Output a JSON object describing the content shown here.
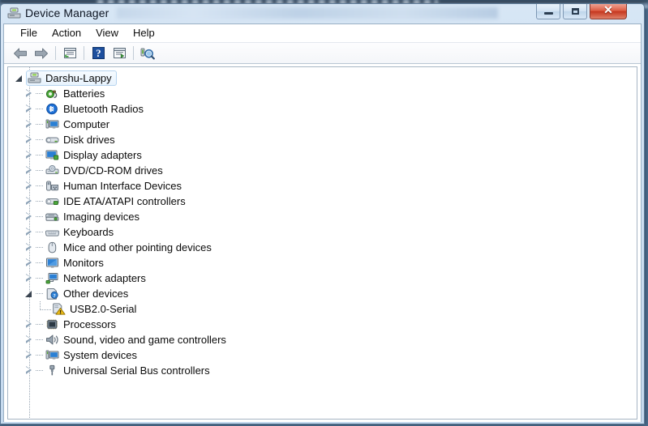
{
  "window": {
    "title": "Device Manager",
    "title_icon": "device-manager-icon",
    "has_blurred_title_region": true,
    "buttons": {
      "minimize": "minimize-button",
      "maximize": "maximize-button",
      "close": "close-button",
      "close_glyph": "✕"
    }
  },
  "menubar": {
    "items": [
      {
        "label": "File",
        "name": "menu-file"
      },
      {
        "label": "Action",
        "name": "menu-action"
      },
      {
        "label": "View",
        "name": "menu-view"
      },
      {
        "label": "Help",
        "name": "menu-help"
      }
    ]
  },
  "toolbar": {
    "items": [
      {
        "name": "back-button",
        "icon": "back-arrow-icon",
        "type": "button"
      },
      {
        "name": "forward-button",
        "icon": "forward-arrow-icon",
        "type": "button"
      },
      {
        "name": "toolbar-separator-1",
        "type": "separator"
      },
      {
        "name": "properties-button",
        "icon": "properties-icon",
        "type": "button"
      },
      {
        "name": "toolbar-separator-2",
        "type": "separator"
      },
      {
        "name": "help-button",
        "icon": "help-question-icon",
        "type": "button"
      },
      {
        "name": "update-driver-button",
        "icon": "update-driver-icon",
        "type": "button"
      },
      {
        "name": "toolbar-separator-3",
        "type": "separator"
      },
      {
        "name": "scan-hardware-changes-button",
        "icon": "scan-hardware-icon",
        "type": "button"
      }
    ]
  },
  "tree": {
    "root": {
      "label": "Darshu-Lappy",
      "icon": "computer-node-icon",
      "selected": true,
      "expanded": true
    },
    "nodes": [
      {
        "label": "Batteries",
        "icon": "battery-icon",
        "expanded": false,
        "has_children": true
      },
      {
        "label": "Bluetooth Radios",
        "icon": "bluetooth-icon",
        "expanded": false,
        "has_children": true
      },
      {
        "label": "Computer",
        "icon": "computer-icon",
        "expanded": false,
        "has_children": true
      },
      {
        "label": "Disk drives",
        "icon": "disk-drive-icon",
        "expanded": false,
        "has_children": true
      },
      {
        "label": "Display adapters",
        "icon": "display-adapter-icon",
        "expanded": false,
        "has_children": true
      },
      {
        "label": "DVD/CD-ROM drives",
        "icon": "dvd-drive-icon",
        "expanded": false,
        "has_children": true
      },
      {
        "label": "Human Interface Devices",
        "icon": "hid-icon",
        "expanded": false,
        "has_children": true
      },
      {
        "label": "IDE ATA/ATAPI controllers",
        "icon": "ide-controller-icon",
        "expanded": false,
        "has_children": true
      },
      {
        "label": "Imaging devices",
        "icon": "imaging-device-icon",
        "expanded": false,
        "has_children": true
      },
      {
        "label": "Keyboards",
        "icon": "keyboard-icon",
        "expanded": false,
        "has_children": true
      },
      {
        "label": "Mice and other pointing devices",
        "icon": "mouse-icon",
        "expanded": false,
        "has_children": true
      },
      {
        "label": "Monitors",
        "icon": "monitor-icon",
        "expanded": false,
        "has_children": true
      },
      {
        "label": "Network adapters",
        "icon": "network-adapter-icon",
        "expanded": false,
        "has_children": true
      },
      {
        "label": "Other devices",
        "icon": "other-devices-icon",
        "expanded": true,
        "has_children": true,
        "children": [
          {
            "label": "USB2.0-Serial",
            "icon": "unknown-device-icon",
            "warning": true
          }
        ]
      },
      {
        "label": "Processors",
        "icon": "processor-icon",
        "expanded": false,
        "has_children": true
      },
      {
        "label": "Sound, video and game controllers",
        "icon": "sound-controller-icon",
        "expanded": false,
        "has_children": true
      },
      {
        "label": "System devices",
        "icon": "system-device-icon",
        "expanded": false,
        "has_children": true
      },
      {
        "label": "Universal Serial Bus controllers",
        "icon": "usb-controller-icon",
        "expanded": false,
        "has_children": true
      }
    ]
  },
  "colors": {
    "accent": "#2a6bbf",
    "warning": "#f5c518",
    "close_button": "#c5371f",
    "selection_border": "#b6d4ef",
    "frame": "#cfe0f2"
  }
}
